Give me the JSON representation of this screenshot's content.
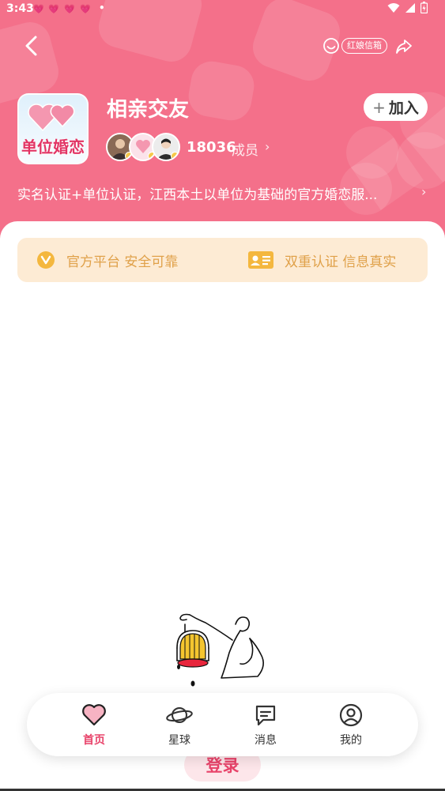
{
  "status_bar": {
    "time": "3:43"
  },
  "header": {
    "mailbox_label": "红娘信箱",
    "group": {
      "logo_text": "单位婚恋",
      "name": "相亲交友",
      "join_label": "加入",
      "join_plus": "+",
      "member_count": "18036",
      "member_label": "成员",
      "description": "实名认证+单位认证，江西本土以单位为基础的官方婚恋服..."
    }
  },
  "trust_banner": {
    "left_text": "官方平台 安全可靠",
    "right_text": "双重认证 信息真实",
    "accent_color": "#e0a14a"
  },
  "login": {
    "label": "登录"
  },
  "tabbar": {
    "items": [
      {
        "label": "首页",
        "icon": "heart-icon",
        "active": true
      },
      {
        "label": "星球",
        "icon": "planet-icon",
        "active": false
      },
      {
        "label": "消息",
        "icon": "message-icon",
        "active": false
      },
      {
        "label": "我的",
        "icon": "profile-icon",
        "active": false
      }
    ]
  },
  "colors": {
    "header_bg": "#f4708a",
    "active_tab": "#e8436a"
  }
}
